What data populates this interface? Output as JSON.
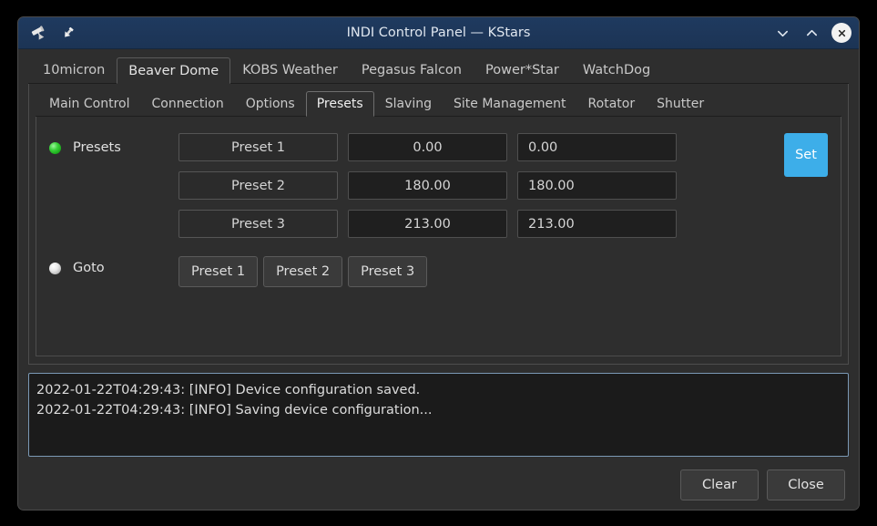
{
  "window": {
    "title": "INDI Control Panel — KStars",
    "app_icon": "telescope-icon",
    "pin_icon": "pin-icon",
    "controls": {
      "minimize": "chevron-down-icon",
      "maximize": "chevron-up-icon",
      "close": "close-icon"
    },
    "titlebar_color": "#1f3a5f"
  },
  "device_tabs": [
    {
      "label": "10micron",
      "active": false
    },
    {
      "label": "Beaver Dome",
      "active": true
    },
    {
      "label": "KOBS Weather",
      "active": false
    },
    {
      "label": "Pegasus Falcon",
      "active": false
    },
    {
      "label": "Power*Star",
      "active": false
    },
    {
      "label": "WatchDog",
      "active": false
    }
  ],
  "sub_tabs": [
    {
      "label": "Main Control",
      "active": false
    },
    {
      "label": "Connection",
      "active": false
    },
    {
      "label": "Options",
      "active": false
    },
    {
      "label": "Presets",
      "active": true
    },
    {
      "label": "Slaving",
      "active": false
    },
    {
      "label": "Site Management",
      "active": false
    },
    {
      "label": "Rotator",
      "active": false
    },
    {
      "label": "Shutter",
      "active": false
    }
  ],
  "presets_property": {
    "label": "Presets",
    "led_state": "ok",
    "led_color": "#2ecc2e",
    "rows": [
      {
        "name": "Preset 1",
        "value": "0.00",
        "input": "0.00"
      },
      {
        "name": "Preset 2",
        "value": "180.00",
        "input": "180.00"
      },
      {
        "name": "Preset 3",
        "value": "213.00",
        "input": "213.00"
      }
    ],
    "set_label": "Set",
    "set_color": "#3daee9"
  },
  "goto_property": {
    "label": "Goto",
    "led_state": "idle",
    "led_color": "#e8e8e8",
    "buttons": [
      {
        "label": "Preset 1"
      },
      {
        "label": "Preset 2"
      },
      {
        "label": "Preset 3"
      }
    ]
  },
  "log": {
    "lines": [
      "2022-01-22T04:29:43: [INFO] Device configuration saved.",
      "2022-01-22T04:29:43: [INFO] Saving device configuration..."
    ]
  },
  "footer": {
    "clear_label": "Clear",
    "close_label": "Close"
  }
}
